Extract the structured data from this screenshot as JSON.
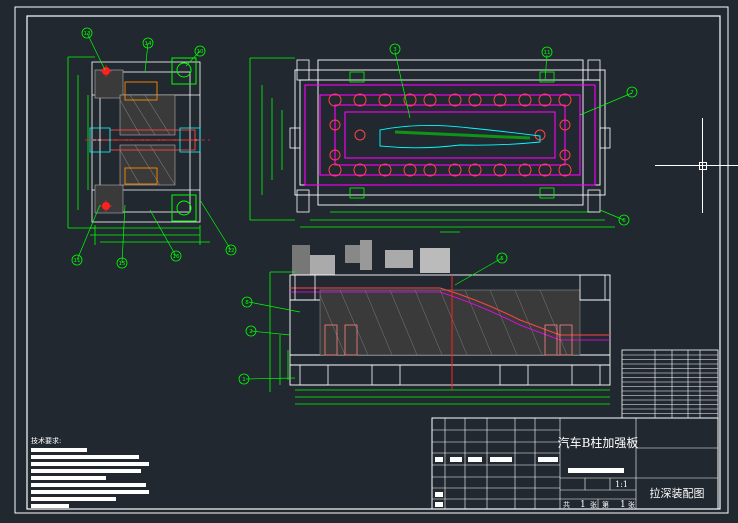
{
  "drawing": {
    "title_cn": "汽车B柱加强板",
    "drawing_name": "拉深装配图",
    "scale": "1:1",
    "sheet_total_label": "共",
    "sheet_total": "1",
    "sheet_total_unit": "张",
    "sheet_no_label": "第",
    "sheet_no": "1",
    "sheet_no_unit": "张"
  },
  "notes": {
    "heading": "技术要求:"
  },
  "balloons_top_left": [
    "13",
    "14",
    "10",
    "11",
    "15",
    "16",
    "12"
  ],
  "balloons_top_right": [
    "3",
    "11",
    "7",
    "6"
  ],
  "balloons_section": [
    "5",
    "8",
    "2",
    "1"
  ],
  "colors": {
    "background": "#212830",
    "outline": "#ffffff",
    "dimension": "#00ff00",
    "die_part": "#ff00ff",
    "punch_part": "#ff4444",
    "centerline": "#ff2020",
    "cavity": "#00ffff",
    "balloon": "#00ff00"
  }
}
